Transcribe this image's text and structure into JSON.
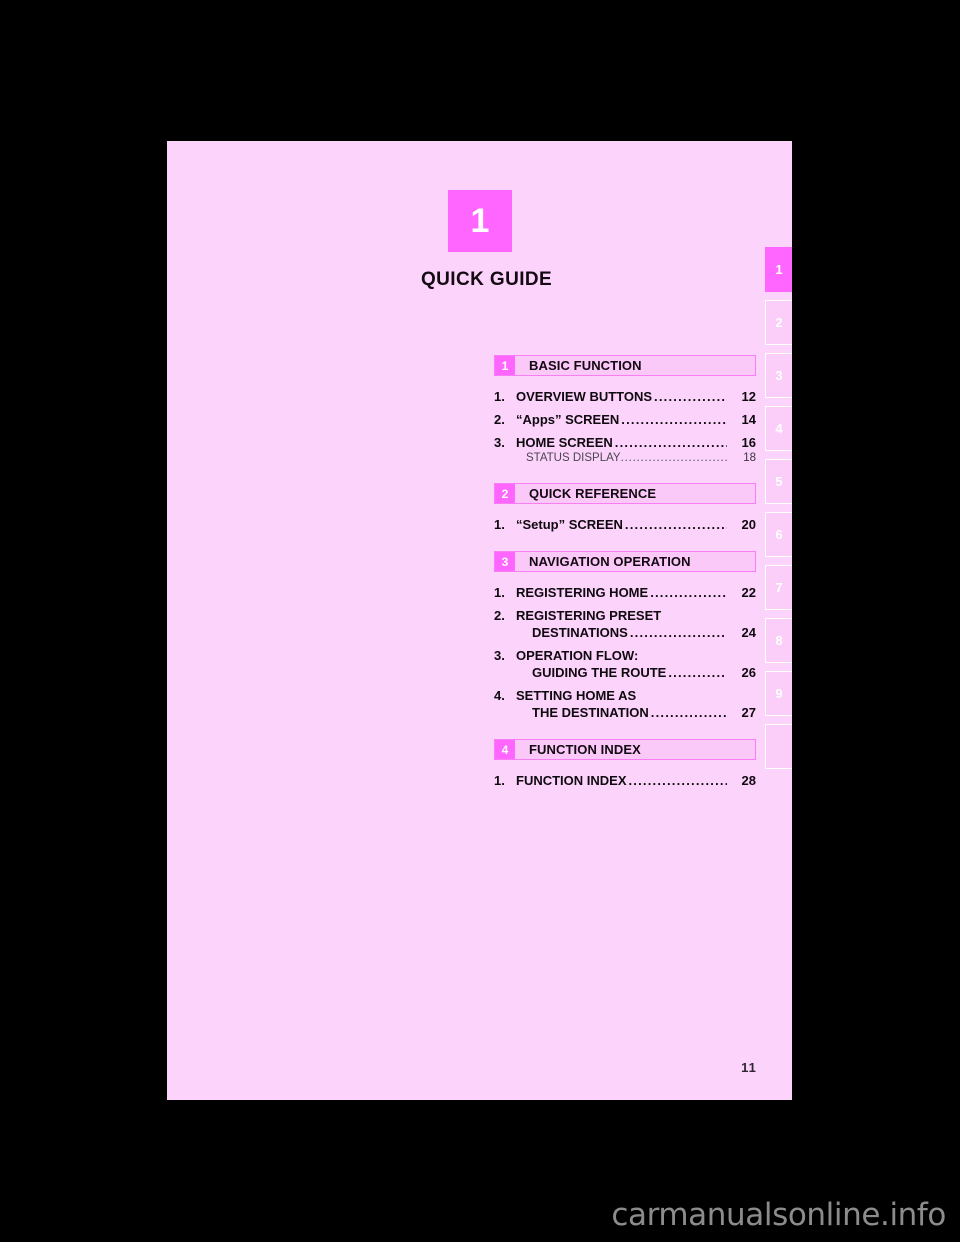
{
  "page": {
    "background_color": "#fcd3fb",
    "accent_color": "#ff66ff",
    "chapter_number": "1",
    "chapter_title": "QUICK GUIDE",
    "page_number": "11"
  },
  "watermark": {
    "text": "carmanualsonline.info"
  },
  "toc": {
    "sections": [
      {
        "number": "1",
        "name": "BASIC FUNCTION",
        "entries": [
          {
            "index": "1.",
            "lines": [
              "OVERVIEW BUTTONS"
            ],
            "page": "12"
          },
          {
            "index": "2.",
            "lines": [
              "“Apps” SCREEN"
            ],
            "page": "14"
          },
          {
            "index": "3.",
            "lines": [
              "HOME SCREEN"
            ],
            "page": "16",
            "sub": {
              "text": "STATUS DISPLAY",
              "page": "18"
            }
          }
        ]
      },
      {
        "number": "2",
        "name": "QUICK REFERENCE",
        "entries": [
          {
            "index": "1.",
            "lines": [
              "“Setup” SCREEN"
            ],
            "page": "20"
          }
        ]
      },
      {
        "number": "3",
        "name": "NAVIGATION OPERATION",
        "entries": [
          {
            "index": "1.",
            "lines": [
              "REGISTERING HOME"
            ],
            "page": "22"
          },
          {
            "index": "2.",
            "lines": [
              "REGISTERING PRESET",
              "DESTINATIONS"
            ],
            "page": "24"
          },
          {
            "index": "3.",
            "lines": [
              "OPERATION FLOW:",
              "GUIDING THE ROUTE"
            ],
            "page": "26"
          },
          {
            "index": "4.",
            "lines": [
              "SETTING HOME AS",
              "THE DESTINATION"
            ],
            "page": "27"
          }
        ]
      },
      {
        "number": "4",
        "name": "FUNCTION INDEX",
        "entries": [
          {
            "index": "1.",
            "lines": [
              "FUNCTION INDEX"
            ],
            "page": "28"
          }
        ]
      }
    ]
  },
  "tab_strip": {
    "active_index": 0,
    "tabs": [
      {
        "label": "1"
      },
      {
        "label": "2"
      },
      {
        "label": "3"
      },
      {
        "label": "4"
      },
      {
        "label": "5"
      },
      {
        "label": "6"
      },
      {
        "label": "7"
      },
      {
        "label": "8"
      },
      {
        "label": "9"
      },
      {
        "label": ""
      }
    ]
  }
}
